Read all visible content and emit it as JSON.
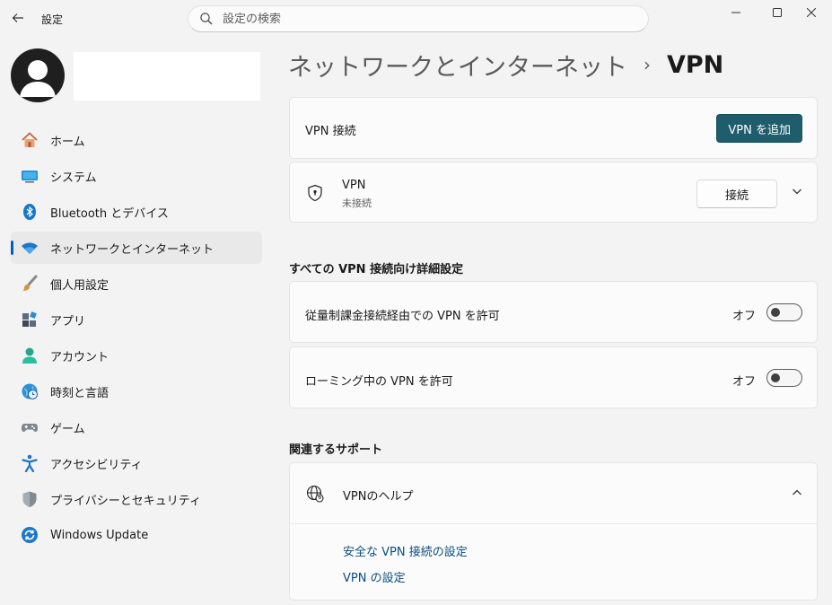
{
  "titlebar": {
    "app_title": "設定",
    "search_placeholder": "設定の検索"
  },
  "sidebar": {
    "items": [
      {
        "label": "ホーム",
        "icon": "home-icon"
      },
      {
        "label": "システム",
        "icon": "system-icon"
      },
      {
        "label": "Bluetooth とデバイス",
        "icon": "bluetooth-icon"
      },
      {
        "label": "ネットワークとインターネット",
        "icon": "wifi-icon",
        "active": true
      },
      {
        "label": "個人用設定",
        "icon": "brush-icon"
      },
      {
        "label": "アプリ",
        "icon": "apps-icon"
      },
      {
        "label": "アカウント",
        "icon": "account-icon"
      },
      {
        "label": "時刻と言語",
        "icon": "clock-globe-icon"
      },
      {
        "label": "ゲーム",
        "icon": "gamepad-icon"
      },
      {
        "label": "アクセシビリティ",
        "icon": "accessibility-icon"
      },
      {
        "label": "プライバシーとセキュリティ",
        "icon": "shield-icon"
      },
      {
        "label": "Windows Update",
        "icon": "update-icon"
      }
    ]
  },
  "breadcrumb": {
    "parent": "ネットワークとインターネット",
    "separator": "›",
    "current": "VPN"
  },
  "vpn_connections": {
    "label": "VPN 接続",
    "add_button": "VPN を追加"
  },
  "vpn_item": {
    "name": "VPN",
    "status": "未接続",
    "connect_button": "接続"
  },
  "advanced": {
    "title": "すべての VPN 接続向け詳細設定",
    "metered": {
      "label": "従量制課金接続経由での VPN を許可",
      "state": "オフ"
    },
    "roaming": {
      "label": "ローミング中の VPN を許可",
      "state": "オフ"
    }
  },
  "support": {
    "title": "関連するサポート",
    "help_label": "VPNのヘルプ",
    "links": [
      "安全な VPN 接続の設定",
      "VPN の設定"
    ]
  },
  "colors": {
    "accent": "#1e5d6c",
    "nav_indicator": "#005fb8",
    "link": "#0b4d80"
  }
}
